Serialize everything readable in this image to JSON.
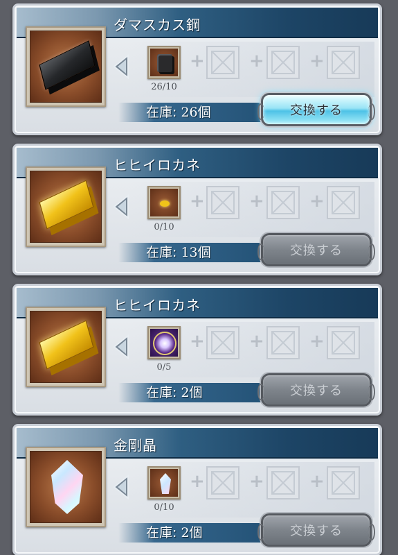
{
  "colors": {
    "title_bar_dark": "#1d4566",
    "stock_bar": "#36678d",
    "active_button": "#4ec2e6",
    "disabled_button": "#7e848b",
    "card_bg": "#e4e8ec"
  },
  "cards": [
    {
      "title": "ダマスカス鋼",
      "item_icon": "damascus-steel-ingot-icon",
      "requirement_icon": "dark-ore-icon",
      "requirement_count": "26/10",
      "stock_label": "在庫: ",
      "stock_value": "26",
      "stock_unit": "個",
      "button_label": "交換する",
      "button_state": "active"
    },
    {
      "title": "ヒヒイロカネ",
      "item_icon": "gold-ingot-icon",
      "requirement_icon": "gold-nugget-icon",
      "requirement_count": "0/10",
      "stock_label": "在庫: ",
      "stock_value": "13",
      "stock_unit": "個",
      "button_label": "交換する",
      "button_state": "disabled"
    },
    {
      "title": "ヒヒイロカネ",
      "item_icon": "gold-ingot-icon",
      "requirement_icon": "purple-crest-icon",
      "requirement_count": "0/5",
      "stock_label": "在庫: ",
      "stock_value": "2",
      "stock_unit": "個",
      "button_label": "交換する",
      "button_state": "disabled"
    },
    {
      "title": "金剛晶",
      "item_icon": "diamond-crystal-icon",
      "requirement_icon": "crystal-shard-icon",
      "requirement_count": "0/10",
      "stock_label": "在庫: ",
      "stock_value": "2",
      "stock_unit": "個",
      "button_label": "交換する",
      "button_state": "disabled"
    }
  ]
}
